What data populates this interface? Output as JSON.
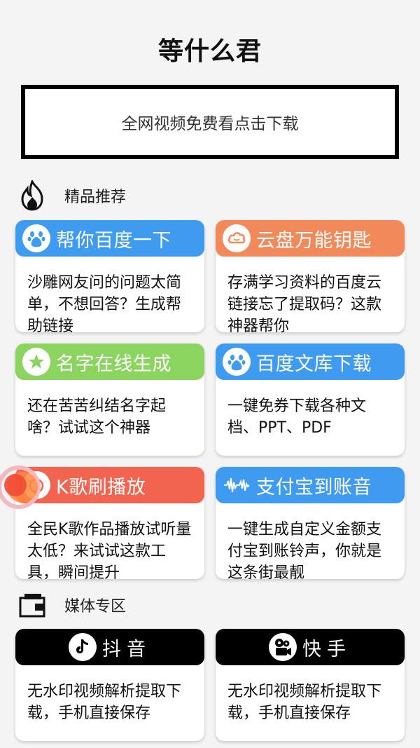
{
  "app": {
    "title": "等什么君"
  },
  "banner": {
    "label": "全网视频免费看点击下载"
  },
  "sections": {
    "featured": {
      "label": "精品推荐",
      "icon": "fire-icon"
    },
    "media": {
      "label": "媒体专区",
      "icon": "wallet-icon"
    }
  },
  "cards": [
    {
      "title": "帮你百度一下",
      "desc": "沙雕网友问的问题太简单，不想回答？生成帮助链接",
      "color": "#3f9bf0",
      "icon": "paw-icon"
    },
    {
      "title": "云盘万能钥匙",
      "desc": "存满学习资料的百度云链接忘了提取码？这款神器帮你",
      "color": "#f2895a",
      "icon": "cloud-icon"
    },
    {
      "title": "名字在线生成",
      "desc": "还在苦苦纠结名字起啥？试试这个神器",
      "color": "#8bd45f",
      "icon": "star-icon"
    },
    {
      "title": "百度文库下载",
      "desc": "一键免券下载各种文档、PPT、PDF",
      "color": "#3f9bf0",
      "icon": "paw-icon"
    },
    {
      "title": "K歌刷播放",
      "desc": "全民K歌作品播放试听量太低？来试试这款工具，瞬间提升",
      "color": "#f2644f",
      "icon": "bird-icon"
    },
    {
      "title": "支付宝到账音",
      "desc": "一键生成自定义金额支付宝到账铃声，你就是这条街最靓",
      "color": "#3f9bf0",
      "icon": "soundwave-icon"
    }
  ],
  "media_cards": [
    {
      "title": "抖音",
      "desc": "无水印视频解析提取下载，手机直接保存",
      "icon": "tiktok-icon"
    },
    {
      "title": "快手",
      "desc": "无水印视频解析提取下载，手机直接保存",
      "icon": "film-reel-icon"
    }
  ],
  "colors": {
    "media_head": "#000000",
    "banner_border": "#000000"
  }
}
